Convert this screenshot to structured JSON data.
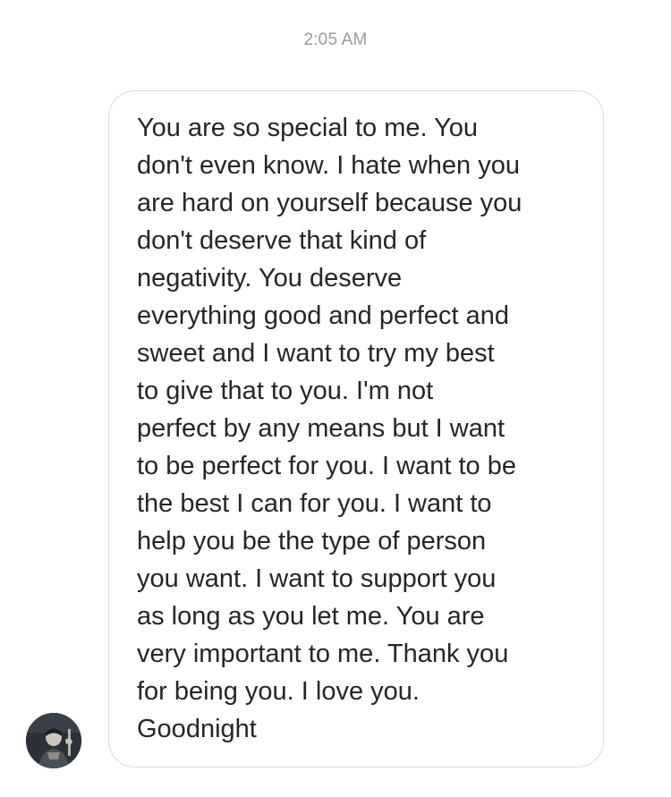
{
  "thread": {
    "timestamp": "2:05 AM"
  },
  "message": {
    "sender": "received",
    "lines": [
      "You are so special to me. You",
      "don't even know. I hate when you",
      "are hard on yourself because you",
      "don't deserve that kind of",
      "negativity. You deserve",
      "everything good and perfect and",
      "sweet and I want to try my best",
      "to give that to you. I'm not",
      "perfect by any means but I want",
      "to be perfect for you. I want to be",
      "the best I can for you. I want to",
      "help you be the type of person",
      "you want. I want to support you",
      "as long as you let me. You are",
      "very important to me. Thank you",
      "for being you. I love you.",
      "Goodnight"
    ]
  },
  "avatar": {
    "icon": "profile-photo",
    "colors": {
      "background": "#2c3038",
      "figure": "#c9c6c0"
    }
  }
}
